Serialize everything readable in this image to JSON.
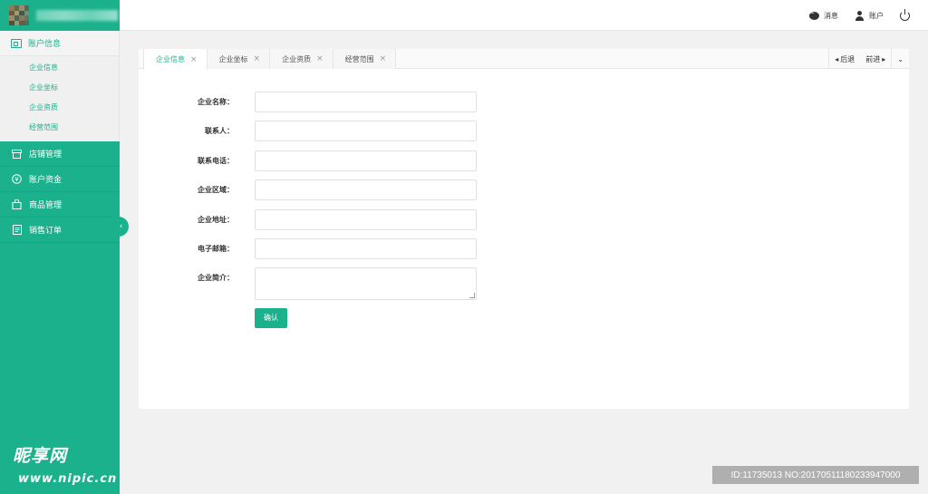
{
  "sidebar": {
    "account_section": "账户信息",
    "sub_items": [
      "企业信息",
      "企业坐标",
      "企业资质",
      "经营范围"
    ],
    "nav_items": [
      {
        "label": "店铺管理",
        "icon": "store-icon"
      },
      {
        "label": "账户资金",
        "icon": "yen-icon"
      },
      {
        "label": "商品管理",
        "icon": "bag-icon"
      },
      {
        "label": "销售订单",
        "icon": "order-icon"
      }
    ]
  },
  "topbar": {
    "messages_label": "消息",
    "account_label": "账户"
  },
  "tabs": [
    {
      "label": "企业信息",
      "active": true
    },
    {
      "label": "企业坐标",
      "active": false
    },
    {
      "label": "企业资质",
      "active": false
    },
    {
      "label": "经营范围",
      "active": false
    }
  ],
  "tab_nav": {
    "back_label": "后退",
    "forward_label": "前进"
  },
  "form": {
    "fields": [
      {
        "label": "企业名称：",
        "value": ""
      },
      {
        "label": "联系人：",
        "value": ""
      },
      {
        "label": "联系电话：",
        "value": ""
      },
      {
        "label": "企业区域：",
        "value": ""
      },
      {
        "label": "企业地址：",
        "value": ""
      },
      {
        "label": "电子邮箱：",
        "value": ""
      }
    ],
    "intro_label": "企业简介：",
    "confirm_label": "确认"
  },
  "watermark": {
    "site": "昵享网",
    "url": "www.nipic.cn",
    "id_text": "ID:11735013 NO:20170511180233947000"
  },
  "colors": {
    "accent": "#1bb18c"
  }
}
